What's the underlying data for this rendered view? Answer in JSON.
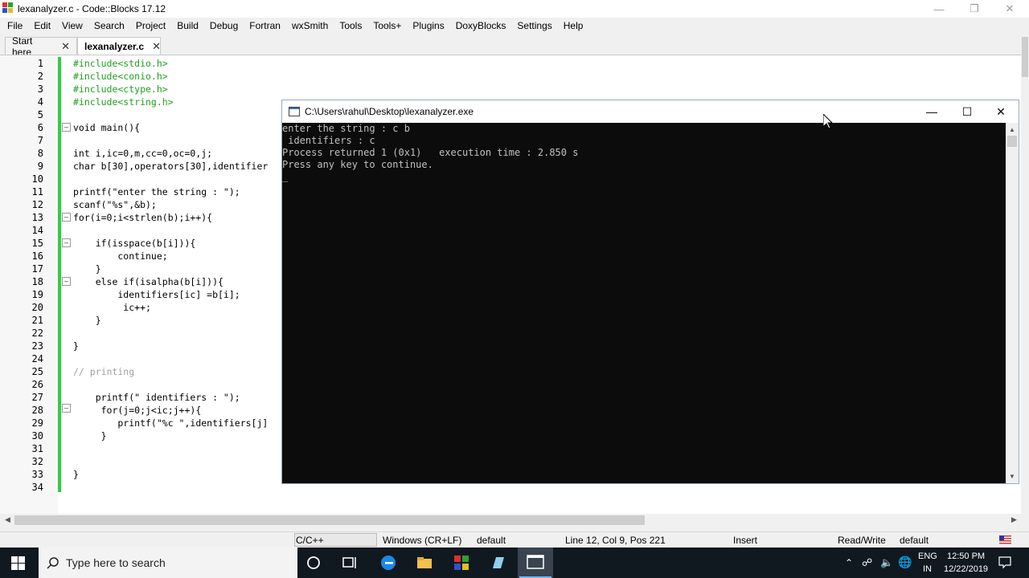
{
  "window": {
    "title": "lexanalyzer.c - Code::Blocks 17.12"
  },
  "menu": [
    "File",
    "Edit",
    "View",
    "Search",
    "Project",
    "Build",
    "Debug",
    "Fortran",
    "wxSmith",
    "Tools",
    "Tools+",
    "Plugins",
    "DoxyBlocks",
    "Settings",
    "Help"
  ],
  "tabs": [
    {
      "label": "Start here",
      "active": false
    },
    {
      "label": "lexanalyzer.c",
      "active": true
    }
  ],
  "editor": {
    "line_numbers": [
      "1",
      "2",
      "3",
      "4",
      "5",
      "6",
      "7",
      "8",
      "9",
      "10",
      "11",
      "12",
      "13",
      "14",
      "15",
      "16",
      "17",
      "18",
      "19",
      "20",
      "21",
      "22",
      "23",
      "24",
      "25",
      "26",
      "27",
      "28",
      "29",
      "30",
      "31",
      "32",
      "33",
      "34"
    ],
    "lines": [
      "#include<stdio.h>",
      "#include<conio.h>",
      "#include<ctype.h>",
      "#include<string.h>",
      "",
      "void main(){",
      "",
      "int i,ic=0,m,cc=0,oc=0,j;",
      "char b[30],operators[30],identifier",
      "",
      "printf(\"enter the string : \");",
      "scanf(\"%s\",&b);",
      "for(i=0;i<strlen(b);i++){",
      "",
      "    if(isspace(b[i])){",
      "        continue;",
      "    }",
      "    else if(isalpha(b[i])){",
      "        identifiers[ic] =b[i];",
      "         ic++;",
      "    }",
      "",
      "}",
      "",
      "// printing",
      "",
      "    printf(\" identifiers : \");",
      "     for(j=0;j<ic;j++){",
      "        printf(\"%c \",identifiers[j]",
      "     }",
      "",
      "",
      "}",
      ""
    ]
  },
  "console": {
    "title": "C:\\Users\\rahul\\Desktop\\lexanalyzer.exe",
    "lines": [
      "enter the string : c b",
      " identifiers : c",
      "Process returned 1 (0x1)   execution time : 2.850 s",
      "Press any key to continue.",
      "_"
    ]
  },
  "statusbar": {
    "language": "C/C++",
    "eol": "Windows (CR+LF)",
    "encoding": "default",
    "position": "Line 12, Col 9, Pos 221",
    "mode": "Insert",
    "access": "Read/Write",
    "profile": "default"
  },
  "taskbar": {
    "search_placeholder": "Type here to search",
    "language_top": "ENG",
    "language_bottom": "IN",
    "time": "12:50 PM",
    "date": "12/22/2019"
  },
  "colors": {
    "console_bg": "#0c0c0c",
    "console_text": "#c0c0c0",
    "gutter_change_bar": "#33cc44",
    "taskbar_bg": "#101820",
    "preprocessor": "#20a020",
    "string": "#0000ff",
    "number": "#f000f0"
  }
}
